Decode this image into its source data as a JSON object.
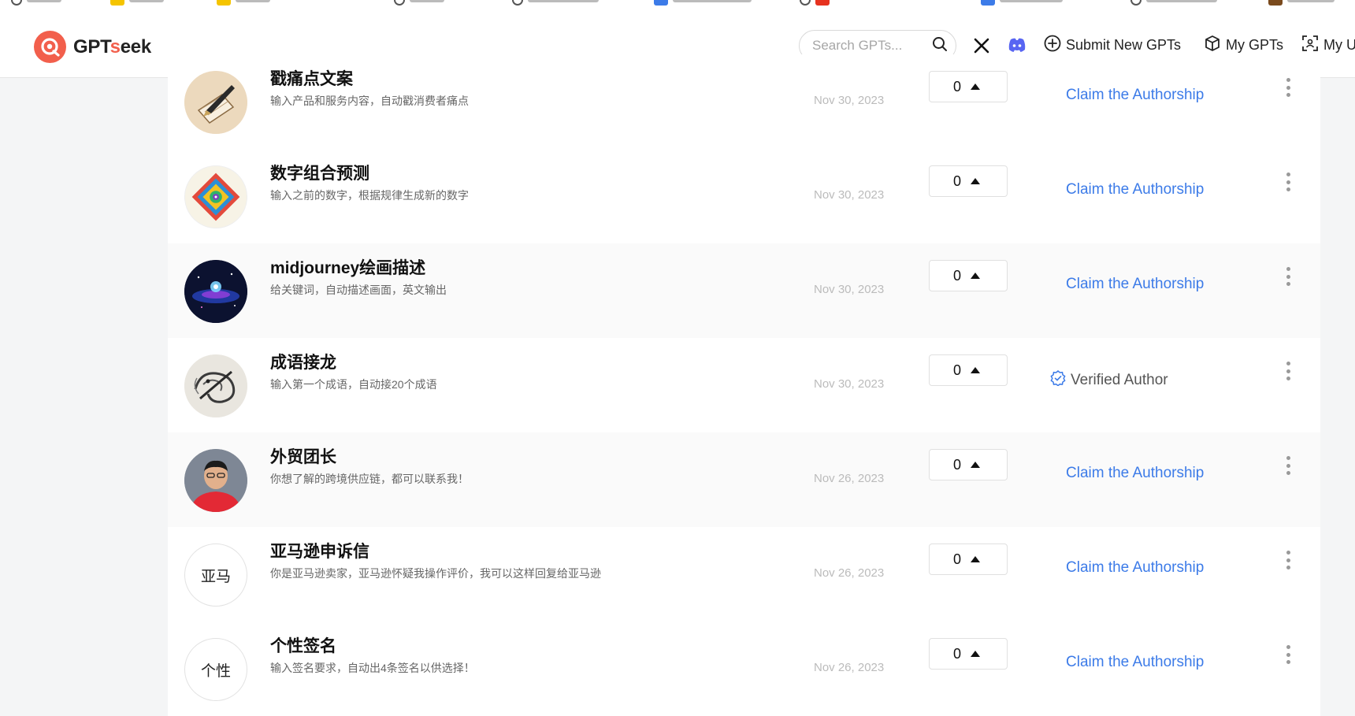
{
  "header": {
    "logo_text_main": "GPT",
    "logo_text_accent": "s",
    "logo_text_end": "eek",
    "search_placeholder": "Search GPTs...",
    "nav_submit": "Submit New GPTs",
    "nav_my_gpts": "My GPTs",
    "nav_cut": "My U"
  },
  "icons": {
    "logo": "gptseek-logo-icon",
    "search": "search-icon",
    "x": "x-icon",
    "discord": "discord-icon",
    "submit": "plus-circle-icon",
    "my_gpts": "box-icon",
    "my_u": "scan-icon"
  },
  "colors": {
    "accent": "#f25f4c",
    "link": "#3c7be8",
    "discord": "#5865f2"
  },
  "gpts": [
    {
      "title": "戳痛点文案",
      "description": "输入产品和服务内容，自动戳消费者痛点",
      "date": "Nov 30, 2023",
      "votes": "0",
      "avatar_type": "image",
      "avatar_subject": "pen-and-paper",
      "action": "Claim the Authorship"
    },
    {
      "title": "数字组合预测",
      "description": "输入之前的数字，根据规律生成新的数字",
      "date": "Nov 30, 2023",
      "votes": "0",
      "avatar_type": "image",
      "avatar_subject": "colorful-geometric-mandala",
      "action": "Claim the Authorship"
    },
    {
      "title": "midjourney绘画描述",
      "description": "给关键词，自动描述画面，英文输出",
      "date": "Nov 30, 2023",
      "votes": "0",
      "avatar_type": "image",
      "avatar_subject": "cosmic-space",
      "action": "Claim the Authorship"
    },
    {
      "title": "成语接龙",
      "description": "输入第一个成语，自动接20个成语",
      "date": "Nov 30, 2023",
      "votes": "0",
      "avatar_type": "image",
      "avatar_subject": "dragon-sketch",
      "action": "Verified Author",
      "verified": true
    },
    {
      "title": "外贸团长",
      "description": "你想了解的跨境供应链，都可以联系我！",
      "date": "Nov 26, 2023",
      "votes": "0",
      "avatar_type": "image",
      "avatar_subject": "person-photo",
      "action": "Claim the Authorship"
    },
    {
      "title": "亚马逊申诉信",
      "description": "你是亚马逊卖家，亚马逊怀疑我操作评价，我可以这样回复给亚马逊",
      "date": "Nov 26, 2023",
      "votes": "0",
      "avatar_type": "text",
      "avatar_text": "亚马",
      "action": "Claim the Authorship"
    },
    {
      "title": "个性签名",
      "description": "输入签名要求，自动出4条签名以供选择！",
      "date": "Nov 26, 2023",
      "votes": "0",
      "avatar_type": "text",
      "avatar_text": "个性",
      "action": "Claim the Authorship"
    }
  ]
}
